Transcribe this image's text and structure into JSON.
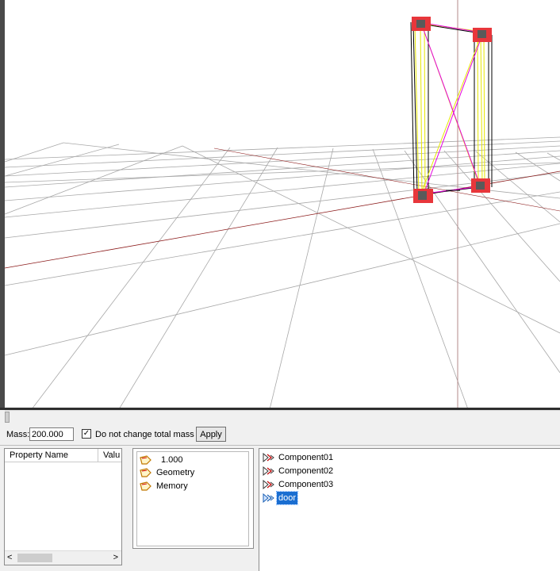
{
  "massbar": {
    "mass_label": "Mass:",
    "mass_value": "200.000",
    "checkbox_checked": true,
    "checkbox_label": "Do not change total mass",
    "apply_label": "Apply"
  },
  "property_grid": {
    "col_name": "Property Name",
    "col_value": "Valu",
    "scroll_left": "<",
    "scroll_right": ">"
  },
  "middle_tree": {
    "items": [
      "1.000",
      "Geometry",
      "Memory"
    ]
  },
  "component_list": {
    "items": [
      "Component01",
      "Component02",
      "Component03",
      "door"
    ],
    "selected": "door"
  },
  "colors": {
    "viewport_bg": "#ffffff",
    "grid": "#a8a8a8",
    "x_axis": "#8b1a1a",
    "y_axis": "#b38a8a",
    "node_fill": "#e8363b",
    "node_core": "#5a5a5a",
    "strut": "#e6e600",
    "cross_brace": "#e400e0",
    "selection": "#1a6ed1"
  }
}
